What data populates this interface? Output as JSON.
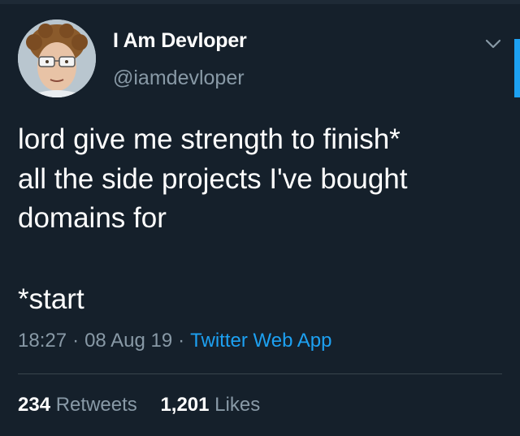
{
  "colors": {
    "background": "#15202b",
    "text_primary": "#ffffff",
    "text_secondary": "#8899a6",
    "link": "#1da1f2",
    "divider": "#38444d"
  },
  "author": {
    "name": "I Am Devloper",
    "handle": "@iamdevloper",
    "avatar_icon": "profile-photo"
  },
  "tweet": {
    "lines": [
      "lord give me strength to finish*",
      "all the side projects I've bought",
      "domains for"
    ],
    "footnote": "*start"
  },
  "meta": {
    "time": "18:27",
    "date": "08 Aug 19",
    "separator": "·",
    "source": "Twitter Web App"
  },
  "stats": {
    "retweets_count": "234",
    "retweets_label": "Retweets",
    "likes_count": "1,201",
    "likes_label": "Likes"
  },
  "icons": {
    "menu": "chevron-down-icon"
  }
}
